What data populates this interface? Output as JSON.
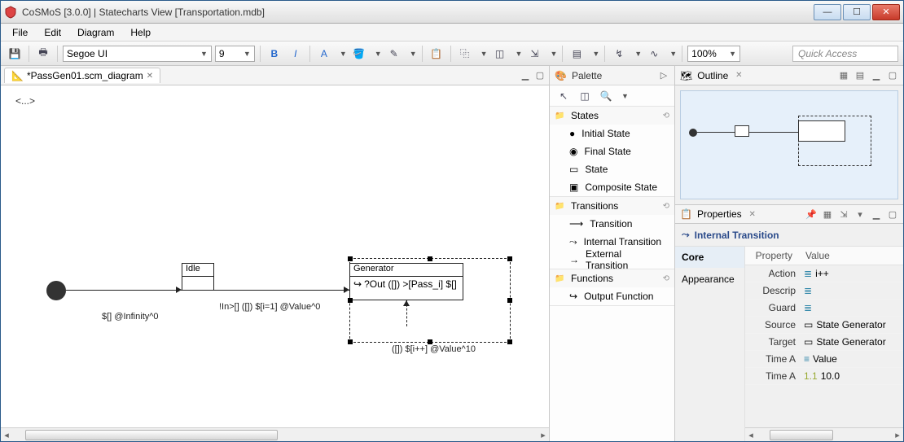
{
  "window": {
    "title": "CoSMoS [3.0.0] | Statecharts View [Transportation.mdb]"
  },
  "menu": {
    "file": "File",
    "edit": "Edit",
    "diagram": "Diagram",
    "help": "Help"
  },
  "toolbar": {
    "font": "Segoe UI",
    "size": "9",
    "zoom": "100%",
    "quick_access_ph": "Quick Access"
  },
  "editor": {
    "tab_label": "*PassGen01.scm_diagram",
    "ellipsis": "<...>",
    "idle_label": "Idle",
    "generator_label": "Generator",
    "gen_body": "?Out ([]) >[Pass_i] $[]",
    "edge_initial": "$[] @Infinity^0",
    "edge_idle_gen": "!In>[] ([]) $[i=1] @Value^0",
    "edge_self": "([]) $[i++] @Value^10"
  },
  "palette": {
    "title": "Palette",
    "groups": {
      "states": "States",
      "transitions": "Transitions",
      "functions": "Functions"
    },
    "items": {
      "initial": "Initial State",
      "final": "Final State",
      "state": "State",
      "composite": "Composite State",
      "transition": "Transition",
      "internal": "Internal Transition",
      "external": "External Transition",
      "output_fn": "Output Function"
    }
  },
  "outline": {
    "title": "Outline"
  },
  "properties": {
    "title": "Properties",
    "heading": "Internal Transition",
    "tabs": {
      "core": "Core",
      "appearance": "Appearance"
    },
    "cols": {
      "property": "Property",
      "value": "Value"
    },
    "rows": {
      "action_k": "Action",
      "action_v": "i++",
      "descrip_k": "Descrip",
      "descrip_v": "",
      "guard_k": "Guard",
      "guard_v": "",
      "source_k": "Source",
      "source_v": "State Generator",
      "target_k": "Target",
      "target_v": "State Generator",
      "timea_k": "Time A",
      "timea_v": "Value",
      "timea2_k": "Time A",
      "timea2_v": "10.0"
    }
  }
}
